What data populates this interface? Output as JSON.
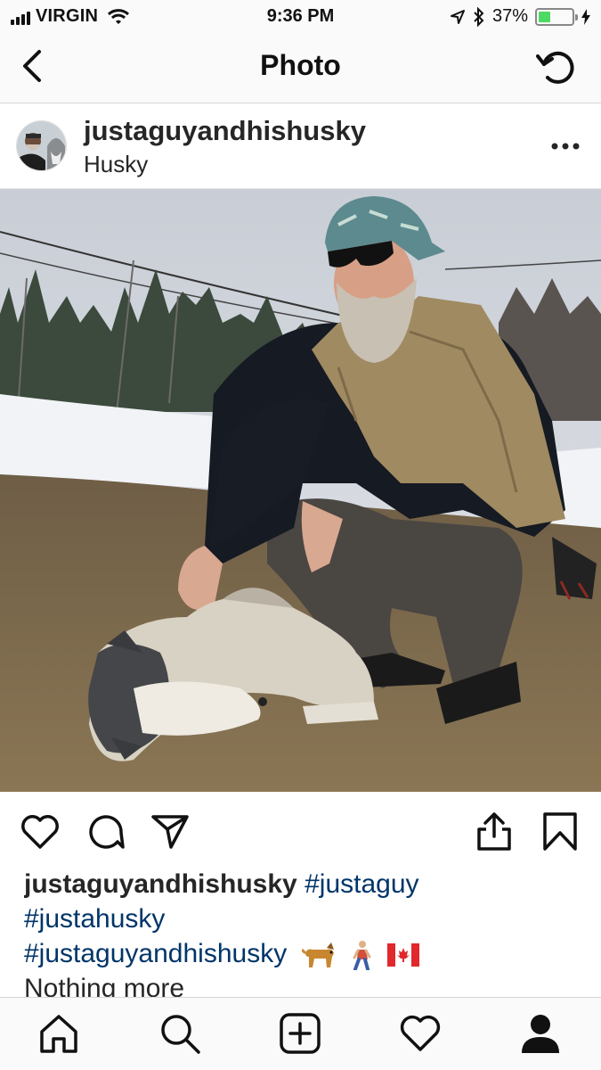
{
  "status_bar": {
    "carrier": "VIRGIN",
    "time": "9:36 PM",
    "battery_percent": "37%",
    "battery_level": 0.37,
    "icons": [
      "signal-icon",
      "wifi-icon",
      "location-arrow-icon",
      "bluetooth-icon",
      "battery-icon",
      "charging-bolt-icon"
    ]
  },
  "nav": {
    "title": "Photo",
    "back_icon": "chevron-left-icon",
    "refresh_icon": "refresh-icon"
  },
  "post": {
    "username": "justaguyandhishusky",
    "location": "Husky",
    "more_icon": "more-horizontal-icon",
    "photo_alt": "photo"
  },
  "actions": {
    "icons": [
      "heart-icon",
      "comment-icon",
      "direct-share-icon",
      "share-upload-icon",
      "bookmark-icon"
    ]
  },
  "caption": {
    "username": "justaguyandhishusky",
    "tag1": "#justaguy",
    "tag2": "#justahusky",
    "tag3": "#justaguyandhishusky",
    "emojis": [
      "dog-emoji",
      "person-walking-emoji",
      "canada-flag-emoji"
    ],
    "more_text": "Nothing more"
  },
  "tab_bar": {
    "icons": [
      "home-icon",
      "search-icon",
      "add-post-icon",
      "activity-heart-icon",
      "profile-icon"
    ]
  },
  "colors": {
    "hashtag": "#003569",
    "text": "#262626",
    "battery": "#4cd964",
    "bars": "#fafafa"
  }
}
